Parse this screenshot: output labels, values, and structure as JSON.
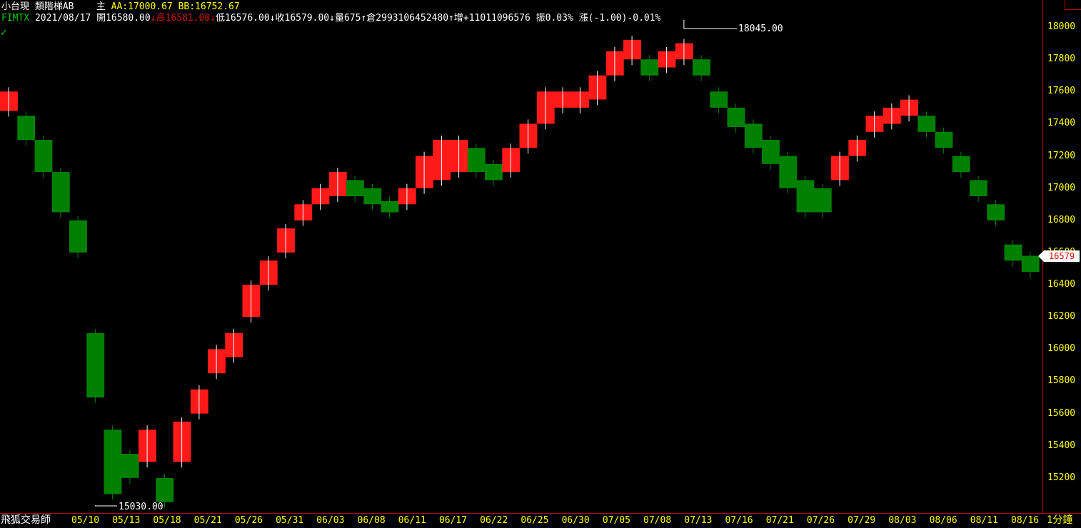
{
  "header": {
    "symbol": "小台現",
    "indicator": "類階梯AB",
    "main_label": "主",
    "aa": "AA:17000.67",
    "bb": "BB:16752.67",
    "code": "FIMTX",
    "date": "2021/08/17",
    "open_label": "開",
    "open": "16580.00",
    "open_arrow": "↓",
    "high_label": "高",
    "high": "16581.00",
    "high_arrow": "↓",
    "low_label": "低",
    "low": "16576.00",
    "low_arrow": "↓",
    "close_label": "收",
    "close": "16579.00",
    "close_arrow": "↓",
    "volume_label": "量",
    "volume": "675",
    "volume_arrow": "↑",
    "oi_label": "倉",
    "oi": "2993106452480",
    "oi_arrow": "↑",
    "change_label": "增",
    "change": "+11011096576",
    "amp_label": "振",
    "amp": "0.03%",
    "rise_label": "漲",
    "rise": "(-1.00)-0.01%"
  },
  "footer": {
    "brand": "飛狐交易師",
    "period": "1分鐘"
  },
  "last_price_label": "16579",
  "annotations": {
    "max_label": "18045.00",
    "min_label": "15030.00"
  },
  "colors": {
    "up": "#ff1a1a",
    "down": "#008000",
    "axis": "#c00000",
    "tick_text": "#ffff00",
    "background": "#000000"
  },
  "chart_data": {
    "type": "step-area",
    "title": "",
    "xlabel": "",
    "ylabel": "",
    "ylim": [
      15000,
      18080
    ],
    "yticks": [
      15200,
      15400,
      15600,
      15800,
      16000,
      16200,
      16400,
      16600,
      16800,
      17000,
      17200,
      17400,
      17600,
      17800,
      18000
    ],
    "xticks": [
      "05/10",
      "05/13",
      "05/18",
      "05/21",
      "05/26",
      "05/31",
      "06/03",
      "06/08",
      "06/11",
      "06/17",
      "06/22",
      "06/25",
      "06/30",
      "07/05",
      "07/08",
      "07/13",
      "07/16",
      "07/21",
      "07/26",
      "07/29",
      "08/03",
      "08/06",
      "08/11",
      "08/16"
    ],
    "max_point": {
      "index": 39,
      "value": 18045
    },
    "min_point": {
      "index": 5,
      "value": 15030
    },
    "last_value": 16579,
    "series": [
      {
        "name": "AA",
        "values": [
          17600,
          17450,
          17300,
          17100,
          16800,
          16100,
          15500,
          15350,
          15500,
          15200,
          15550,
          15750,
          16000,
          16100,
          16400,
          16550,
          16750,
          16900,
          17000,
          17100,
          17050,
          17000,
          16920,
          17000,
          17200,
          17300,
          17300,
          17250,
          17150,
          17250,
          17400,
          17600,
          17600,
          17600,
          17700,
          17850,
          17920,
          17800,
          17850,
          17900,
          17800,
          17600,
          17500,
          17400,
          17300,
          17200,
          17050,
          17000,
          17200,
          17300,
          17450,
          17500,
          17550,
          17450,
          17350,
          17200,
          17050,
          16900,
          16650,
          16580
        ]
      },
      {
        "name": "BB",
        "values": [
          17480,
          17300,
          17100,
          16850,
          16600,
          15700,
          15100,
          15200,
          15300,
          15050,
          15300,
          15600,
          15850,
          15950,
          16200,
          16400,
          16600,
          16800,
          16900,
          16950,
          16950,
          16900,
          16850,
          16900,
          17000,
          17050,
          17100,
          17100,
          17050,
          17100,
          17250,
          17400,
          17500,
          17500,
          17550,
          17700,
          17800,
          17700,
          17750,
          17800,
          17700,
          17500,
          17380,
          17250,
          17150,
          17000,
          16850,
          16850,
          17050,
          17200,
          17350,
          17400,
          17450,
          17350,
          17250,
          17100,
          16950,
          16800,
          16550,
          16480
        ]
      }
    ]
  }
}
